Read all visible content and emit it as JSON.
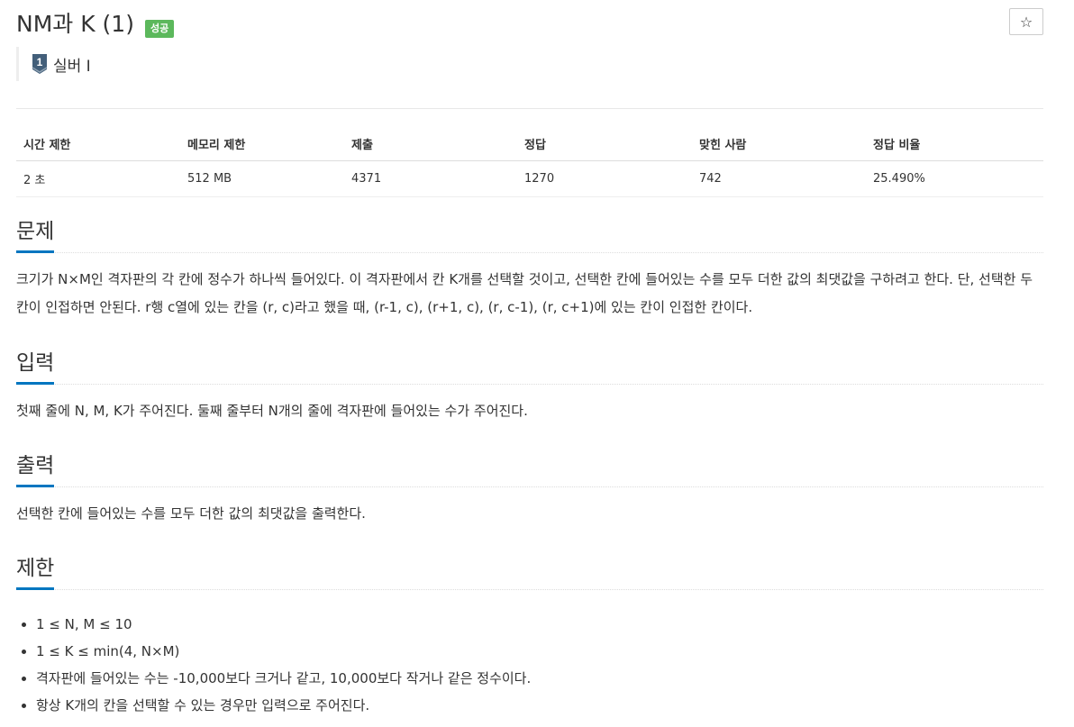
{
  "problem": {
    "title": "NM과 K (1)",
    "status_badge": "성공",
    "tier": "실버 I",
    "tier_number": "1",
    "star_icon": "☆"
  },
  "info_table": {
    "headers": [
      "시간 제한",
      "메모리 제한",
      "제출",
      "정답",
      "맞힌 사람",
      "정답 비율"
    ],
    "values": [
      "2 초",
      "512 MB",
      "4371",
      "1270",
      "742",
      "25.490%"
    ]
  },
  "sections": {
    "problem": {
      "title": "문제",
      "body": "크기가 N×M인 격자판의 각 칸에 정수가 하나씩 들어있다. 이 격자판에서 칸 K개를 선택할 것이고, 선택한 칸에 들어있는 수를 모두 더한 값의 최댓값을 구하려고 한다. 단, 선택한 두 칸이 인접하면 안된다. r행 c열에 있는 칸을 (r, c)라고 했을 때, (r-1, c), (r+1, c), (r, c-1), (r, c+1)에 있는 칸이 인접한 칸이다."
    },
    "input": {
      "title": "입력",
      "body": "첫째 줄에 N, M, K가 주어진다. 둘째 줄부터 N개의 줄에 격자판에 들어있는 수가 주어진다."
    },
    "output": {
      "title": "출력",
      "body": "선택한 칸에 들어있는 수를 모두 더한 값의 최댓값을 출력한다."
    },
    "limits": {
      "title": "제한",
      "items": [
        "1 ≤ N, M ≤ 10",
        "1 ≤ K ≤ min(4, N×M)",
        "격자판에 들어있는 수는 -10,000보다 크거나 같고, 10,000보다 작거나 같은 정수이다.",
        "항상 K개의 칸을 선택할 수 있는 경우만 입력으로 주어진다."
      ]
    }
  },
  "colors": {
    "badge": "#5cb85c",
    "section_underline": "#0076c0",
    "tier_icon": "#435f7a"
  }
}
